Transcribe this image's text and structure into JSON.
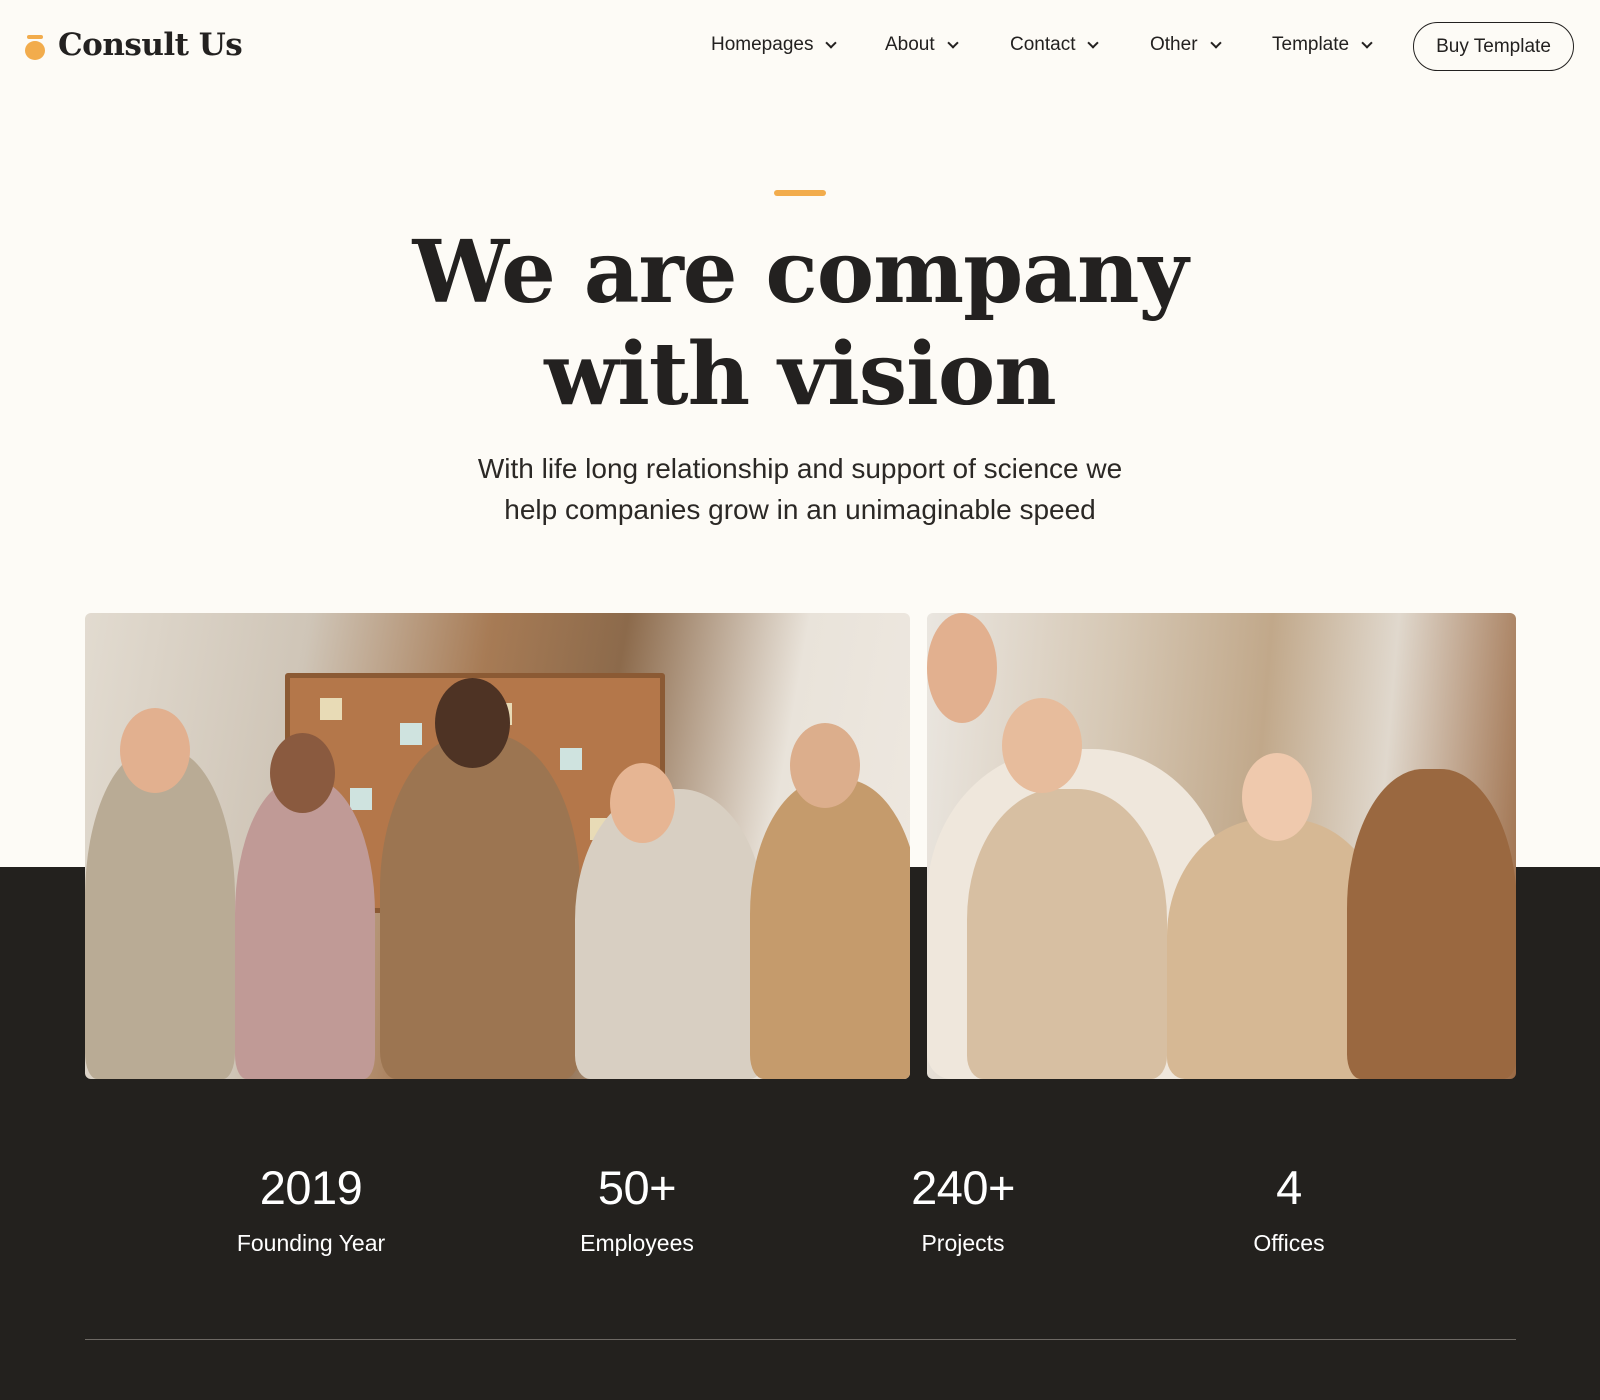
{
  "brand": {
    "name": "Consult Us",
    "accent_color": "#f2ac4c"
  },
  "nav": {
    "items": [
      {
        "label": "Homepages",
        "icon": "chevron-down-icon"
      },
      {
        "label": "About",
        "icon": "chevron-down-icon"
      },
      {
        "label": "Contact",
        "icon": "chevron-down-icon"
      },
      {
        "label": "Other",
        "icon": "chevron-down-icon"
      },
      {
        "label": "Template",
        "icon": "chevron-down-icon"
      }
    ],
    "cta_label": "Buy Template"
  },
  "hero": {
    "title_line1": "We are company",
    "title_line2": "with vision",
    "subtitle_line1": "With life long relationship and support of science we",
    "subtitle_line2": "help companies grow in an unimaginable speed"
  },
  "stats": [
    {
      "value": "2019",
      "label": "Founding Year"
    },
    {
      "value": "50+",
      "label": "Employees"
    },
    {
      "value": "240+",
      "label": "Projects"
    },
    {
      "value": "4",
      "label": "Offices"
    }
  ],
  "colors": {
    "background": "#fdfbf6",
    "dark_section": "#23211e",
    "text": "#232120"
  }
}
